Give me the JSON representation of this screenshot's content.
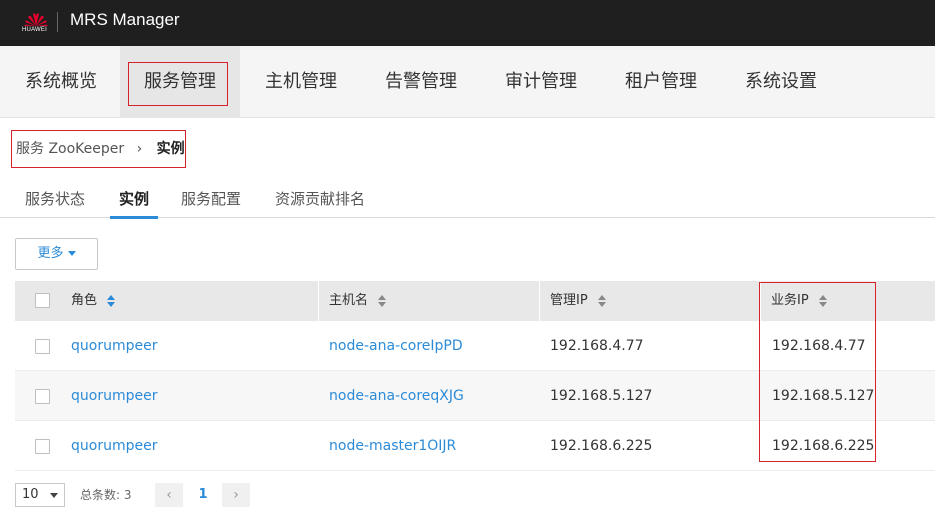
{
  "brand": {
    "logo_text": "HUAWEI",
    "app_title": "MRS Manager"
  },
  "nav": {
    "items": [
      {
        "label": "系统概览"
      },
      {
        "label": "服务管理"
      },
      {
        "label": "主机管理"
      },
      {
        "label": "告警管理"
      },
      {
        "label": "审计管理"
      },
      {
        "label": "租户管理"
      },
      {
        "label": "系统设置"
      }
    ],
    "active_index": 1
  },
  "breadcrumb": {
    "parent": "服务 ZooKeeper",
    "separator": "›",
    "current": "实例"
  },
  "subtabs": [
    {
      "label": "服务状态"
    },
    {
      "label": "实例"
    },
    {
      "label": "服务配置"
    },
    {
      "label": "资源贡献排名"
    }
  ],
  "toolbar": {
    "more_label": "更多"
  },
  "table": {
    "columns": [
      "角色",
      "主机名",
      "管理IP",
      "业务IP"
    ],
    "rows": [
      {
        "role": "quorumpeer",
        "host": "node-ana-coreIpPD",
        "mgmt_ip": "192.168.4.77",
        "biz_ip": "192.168.4.77"
      },
      {
        "role": "quorumpeer",
        "host": "node-ana-coreqXJG",
        "mgmt_ip": "192.168.5.127",
        "biz_ip": "192.168.5.127"
      },
      {
        "role": "quorumpeer",
        "host": "node-master1OIJR",
        "mgmt_ip": "192.168.6.225",
        "biz_ip": "192.168.6.225"
      }
    ]
  },
  "pager": {
    "page_size": "10",
    "total_label": "总条数: 3",
    "prev": "‹",
    "current_page": "1",
    "next": "›"
  },
  "colors": {
    "accent": "#2b8bd8",
    "highlight": "#d6232b",
    "topbar": "#1f1f1f"
  },
  "icons": {
    "logo": "huawei-logo-icon"
  }
}
